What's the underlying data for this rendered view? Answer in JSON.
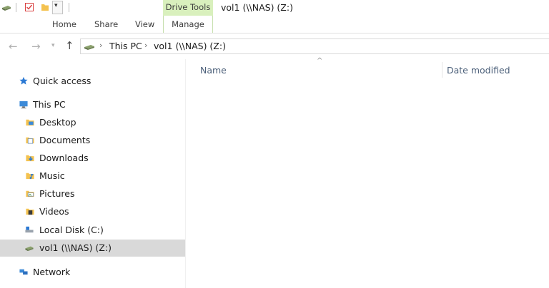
{
  "window": {
    "title": "vol1 (\\\\NAS) (Z:)",
    "context_tab_label": "Drive Tools",
    "context_tab_color": "#d9f0bd"
  },
  "ribbon": {
    "tabs": [
      {
        "label": "Home"
      },
      {
        "label": "Share"
      },
      {
        "label": "View"
      },
      {
        "label": "Manage"
      }
    ]
  },
  "address": {
    "icon": "network-drive-icon",
    "breadcrumbs": [
      "This PC",
      "vol1 (\\\\NAS) (Z:)"
    ]
  },
  "nav": {
    "items": [
      {
        "label": "Quick access",
        "icon": "star-icon"
      },
      {
        "label": "This PC",
        "icon": "computer-icon"
      },
      {
        "label": "Desktop",
        "icon": "desktop-folder-icon"
      },
      {
        "label": "Documents",
        "icon": "documents-folder-icon"
      },
      {
        "label": "Downloads",
        "icon": "downloads-folder-icon"
      },
      {
        "label": "Music",
        "icon": "music-folder-icon"
      },
      {
        "label": "Pictures",
        "icon": "pictures-folder-icon"
      },
      {
        "label": "Videos",
        "icon": "videos-folder-icon"
      },
      {
        "label": "Local Disk (C:)",
        "icon": "local-disk-icon"
      },
      {
        "label": "vol1 (\\\\NAS) (Z:)",
        "icon": "network-drive-icon",
        "selected": true
      },
      {
        "label": "Network",
        "icon": "network-icon"
      }
    ]
  },
  "content": {
    "columns": [
      {
        "label": "Name",
        "sorted": true
      },
      {
        "label": "Date modified"
      }
    ]
  }
}
